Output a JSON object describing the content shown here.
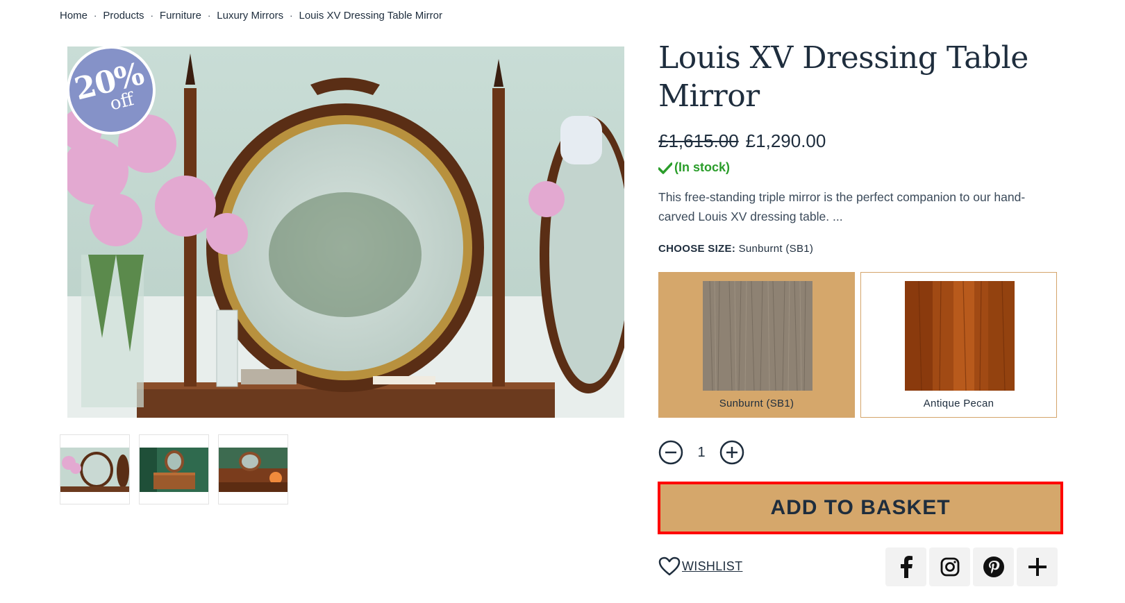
{
  "breadcrumb": [
    {
      "label": "Home"
    },
    {
      "label": "Products"
    },
    {
      "label": "Furniture"
    },
    {
      "label": "Luxury Mirrors"
    },
    {
      "label": "Louis XV Dressing Table Mirror"
    }
  ],
  "breadcrumb_separator": "·",
  "badge": {
    "percent": "20%",
    "suffix": "off",
    "color": "#8592c8"
  },
  "product": {
    "title": "Louis XV Dressing Table Mirror",
    "old_price": "£1,615.00",
    "price": "£1,290.00",
    "stock": "(In stock)",
    "description": "This free-standing triple mirror is the perfect companion to our hand-carved Louis XV dressing table. ...",
    "size_label": "CHOOSE SIZE:",
    "size_selected": "Sunburnt (SB1)"
  },
  "swatches": [
    {
      "label": "Sunburnt (SB1)",
      "selected": true,
      "color": "#8e8273"
    },
    {
      "label": "Antique Pecan",
      "selected": false,
      "color": "#a14a14"
    }
  ],
  "quantity": {
    "value": "1"
  },
  "add_to_basket_label": "ADD TO BASKET",
  "wishlist_label": "WISHLIST",
  "share_icons": [
    "facebook-icon",
    "instagram-icon",
    "pinterest-icon",
    "plus-icon"
  ],
  "colors": {
    "accent": "#d5a76b",
    "text": "#1e2d3d",
    "stock": "#2a9d2a",
    "highlight": "#ff0000"
  }
}
